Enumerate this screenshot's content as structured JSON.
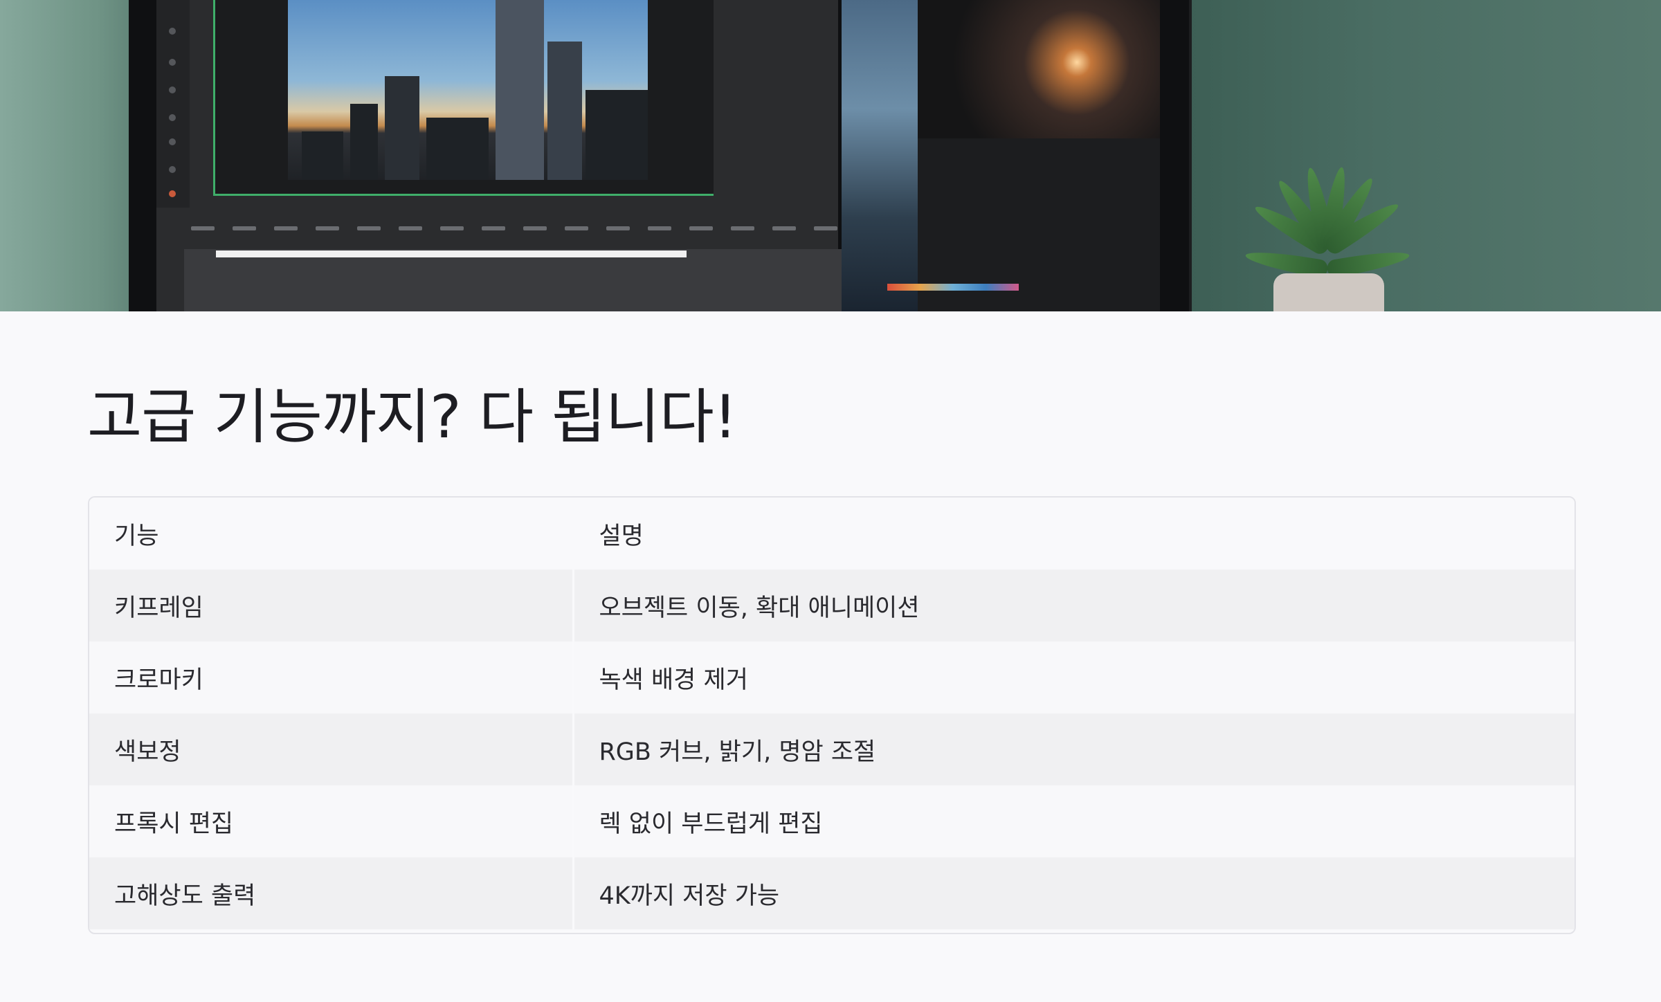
{
  "section": {
    "title": "고급 기능까지? 다 됩니다!"
  },
  "table": {
    "headers": [
      "기능",
      "설명"
    ],
    "rows": [
      [
        "키프레임",
        "오브젝트 이동, 확대 애니메이션"
      ],
      [
        "크로마키",
        "녹색 배경 제거"
      ],
      [
        "색보정",
        "RGB 커브, 밝기, 명암 조절"
      ],
      [
        "프록시 편집",
        "렉 없이 부드럽게 편집"
      ],
      [
        "고해상도 출력",
        "4K까지 저장 가능"
      ]
    ]
  }
}
